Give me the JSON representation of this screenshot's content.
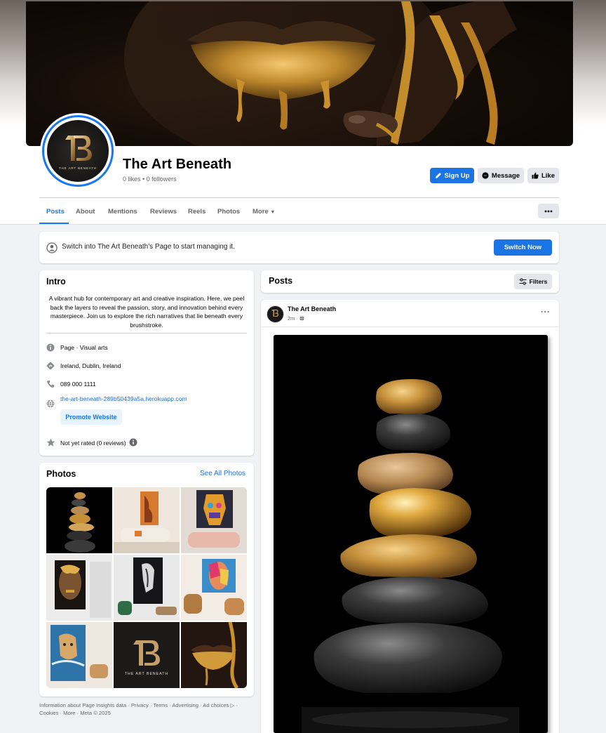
{
  "page": {
    "name": "The Art Beneath",
    "stats": "0 likes • 0 followers",
    "logo_text": "THE ART BENEATH"
  },
  "actions": {
    "sign_up": "Sign Up",
    "message": "Message",
    "like": "Like"
  },
  "tabs": [
    {
      "label": "Posts",
      "active": true
    },
    {
      "label": "About"
    },
    {
      "label": "Mentions"
    },
    {
      "label": "Reviews"
    },
    {
      "label": "Reels"
    },
    {
      "label": "Photos"
    },
    {
      "label": "More"
    }
  ],
  "switch_banner": {
    "text": "Switch into The Art Beneath's Page to start managing it.",
    "button": "Switch Now"
  },
  "intro": {
    "title": "Intro",
    "description": "A vibrant hub for contemporary art and creative inspiration. Here, we peel back the layers to reveal the passion, story, and innovation behind every masterpiece. Join us to explore the rich narratives that lie beneath every brushstroke.",
    "category": "Page · Visual arts",
    "location": "Ireland, Dublin, Ireland",
    "phone": "089 000 1111",
    "website": "the-art-beneath-289b50439a5a.herokuapp.com",
    "promote_button": "Promote Website",
    "rating": "Not yet rated (0 reviews)"
  },
  "photos": {
    "title": "Photos",
    "see_all": "See All Photos"
  },
  "footer": {
    "text": "Information about Page Insights data · Privacy · Terms · Advertising · Ad choices ▷ · Cookies · More · Meta © 2025"
  },
  "posts": {
    "title": "Posts",
    "filters": "Filters",
    "author": "The Art Beneath",
    "time": "2m ·",
    "menu": "···"
  },
  "colors": {
    "brand_blue": "#1877f2",
    "button_blue": "#1b74e4",
    "background": "#f0f2f5"
  }
}
